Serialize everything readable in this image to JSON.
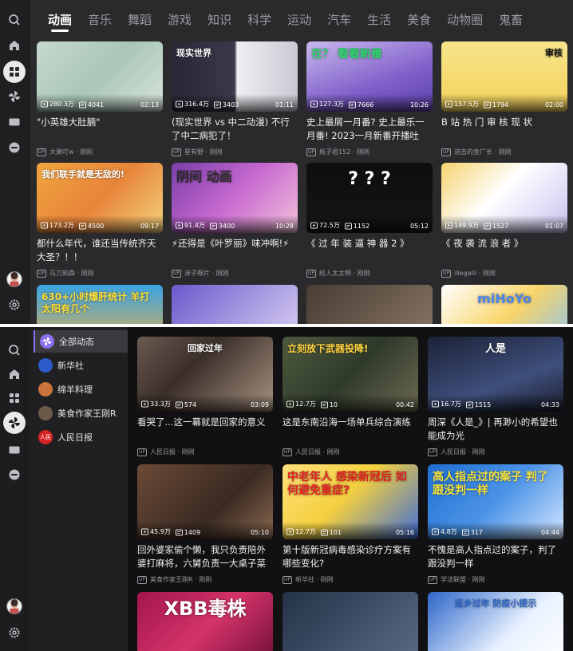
{
  "screen1": {
    "tabs": [
      "动画",
      "音乐",
      "舞蹈",
      "游戏",
      "知识",
      "科学",
      "运动",
      "汽车",
      "生活",
      "美食",
      "动物圈",
      "鬼畜"
    ],
    "active_tab": "动画",
    "cards": [
      {
        "overlay": "",
        "views": "280.3万",
        "danmaku": "4041",
        "duration": "02:13",
        "title": "\"小英雄大肚腩\"",
        "owner": "大果叮w · 刚刚"
      },
      {
        "overlay": "现实世界",
        "views": "316.4万",
        "danmaku": "3403",
        "duration": "01:11",
        "title": "(现实世界 vs 中二动漫) 不行了中二病犯了！",
        "owner": "星有野 · 刚刚"
      },
      {
        "overlay": "在？ 看看新番",
        "views": "127.3万",
        "danmaku": "7666",
        "duration": "10:26",
        "title": "史上最屑一月番? 史上最乐一月番! 2023一月新番开播吐",
        "owner": "瓶子君152 · 刚刚"
      },
      {
        "overlay": "审核",
        "views": "157.5万",
        "danmaku": "1794",
        "duration": "02:00",
        "title": "B 站 热 门 审 核 现 状",
        "owner": "进击的金厂长 · 刚刚"
      },
      {
        "overlay": "我们联手就是无敌的!",
        "views": "173.2万",
        "danmaku": "4500",
        "duration": "09:17",
        "title": "都什么年代，谁还当传统齐天大圣？！！",
        "owner": "马刀刻森 · 刚刚"
      },
      {
        "overlay": "阴间 动画",
        "views": "91.4万",
        "danmaku": "3400",
        "duration": "10:28",
        "title": "⚡还得是《叶罗丽》味冲啊!⚡",
        "owner": "沫子穆片 · 刚刚"
      },
      {
        "overlay": "? ? ?",
        "views": "72.5万",
        "danmaku": "1152",
        "duration": "05:12",
        "title": "《 过 年 装 逼 神 器 2 》",
        "owner": "绘人太太啊 · 刚刚"
      },
      {
        "overlay": "",
        "views": "149.9万",
        "danmaku": "1527",
        "duration": "01:07",
        "title": "《 夜 袭 流 浪 者 》",
        "owner": "illegalll · 刚刚"
      },
      {
        "overlay": "630+小时爆肝统计 羊打太阳有几个",
        "views": "",
        "danmaku": "",
        "duration": "",
        "title": "",
        "owner": ""
      },
      {
        "overlay": "",
        "views": "",
        "danmaku": "",
        "duration": "",
        "title": "",
        "owner": ""
      },
      {
        "overlay": "",
        "views": "",
        "danmaku": "",
        "duration": "",
        "title": "",
        "owner": ""
      },
      {
        "overlay": "miHoYo",
        "views": "",
        "danmaku": "",
        "duration": "",
        "title": "",
        "owner": ""
      }
    ]
  },
  "screen2": {
    "follow_list": [
      {
        "label": "全部动态",
        "avatar": "",
        "color": "#8c6ff0"
      },
      {
        "label": "新华社",
        "avatar": "",
        "color": "#2c5cc8"
      },
      {
        "label": "绵羊料理",
        "avatar": "",
        "color": "#c8743a"
      },
      {
        "label": "美食作家王刚R",
        "avatar": "",
        "color": "#6b5a48"
      },
      {
        "label": "人民日报",
        "avatar": "人民",
        "color": "#d42323"
      }
    ],
    "cards": [
      {
        "overlay": "回家过年",
        "views": "33.3万",
        "danmaku": "574",
        "duration": "03:09",
        "title": "看哭了...这一幕就是回家的意义",
        "owner": "人民日报 · 刚刚"
      },
      {
        "overlay": "立刻放下武器投降!",
        "views": "12.7万",
        "danmaku": "10",
        "duration": "00:42",
        "title": "这是东南沿海一场单兵综合演练",
        "owner": "人民日报 · 刚刚"
      },
      {
        "overlay": "人是",
        "views": "16.7万",
        "danmaku": "1515",
        "duration": "04:33",
        "title": "周深《人是_》| 再渺小的希望也能成为光",
        "owner": "人民日报 · 刚刚"
      },
      {
        "overlay": "",
        "views": "45.9万",
        "danmaku": "1409",
        "duration": "05:10",
        "title": "回外婆家偷个懒，我只负责陪外婆打麻将，六舅负责一大桌子菜",
        "owner": "美食作家王刚R · 刚刚"
      },
      {
        "overlay": "中老年人 感染新冠后 如何避免重症?",
        "views": "12.7万",
        "danmaku": "101",
        "duration": "05:16",
        "title": "第十版新冠病毒感染诊疗方案有哪些变化?",
        "owner": "新华社 · 刚刚"
      },
      {
        "overlay": "高人指点过的案子 判了跟没判一样",
        "views": "4.8万",
        "danmaku": "317",
        "duration": "04:44",
        "title": "不愧是高人指点过的案子，判了跟没判一样",
        "owner": "学法联盟 · 刚刚"
      },
      {
        "overlay": "XBB毒株",
        "views": "",
        "danmaku": "",
        "duration": "",
        "title": "",
        "owner": ""
      },
      {
        "overlay": "",
        "views": "",
        "danmaku": "",
        "duration": "",
        "title": "",
        "owner": ""
      },
      {
        "overlay": "返乡过年 防疫小提示",
        "views": "",
        "danmaku": "",
        "duration": "",
        "title": "",
        "owner": ""
      }
    ]
  },
  "icons": {
    "rail": [
      "search-icon",
      "home-icon",
      "category-icon",
      "following-icon",
      "video-icon",
      "live-icon"
    ],
    "bottom": [
      "avatar",
      "settings-icon"
    ]
  },
  "colors": {
    "rail_bg": "#1f1f22",
    "content_bg": "#2a2a2d",
    "accent": "#8c6ff0",
    "text": "#f0f0f0",
    "muted": "#9a9a9f"
  }
}
